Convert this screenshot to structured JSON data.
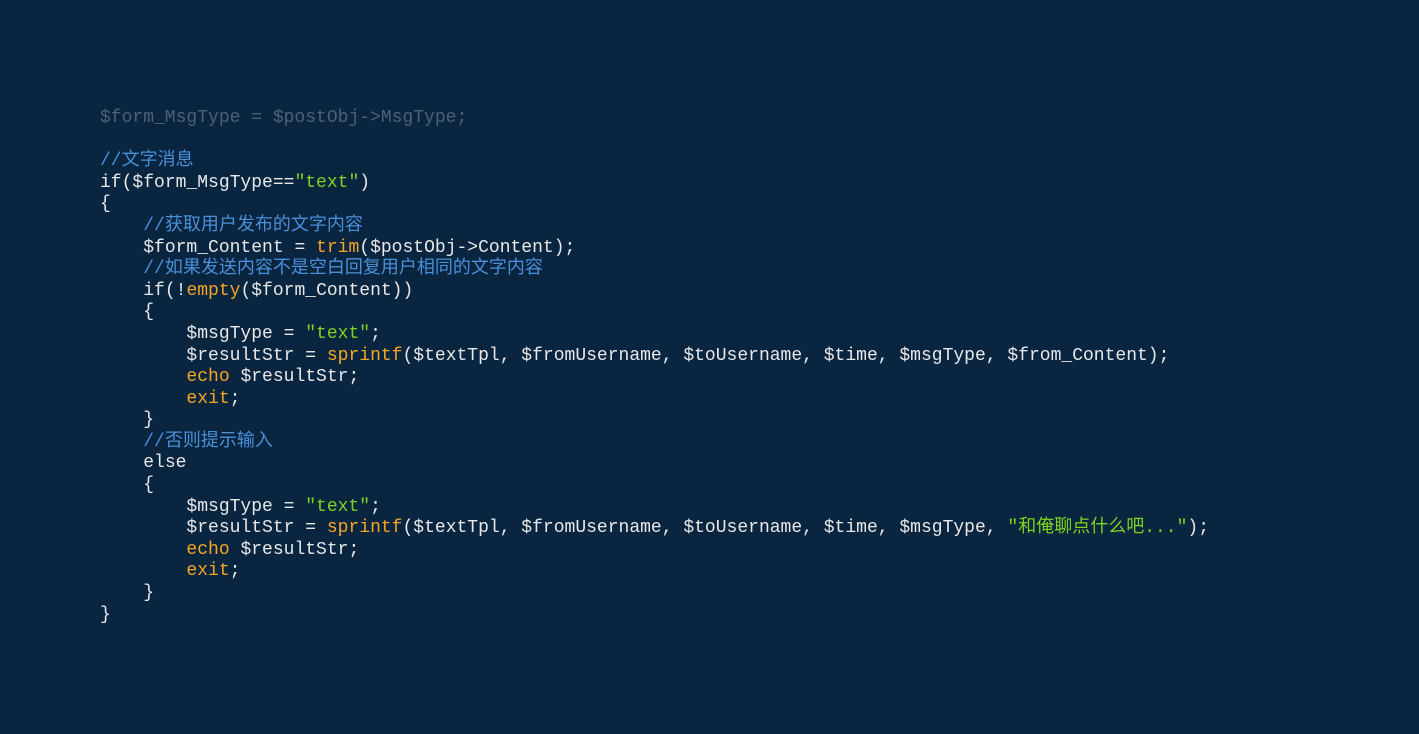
{
  "code": {
    "line0": "$form_MsgType = $postObj->MsgType;",
    "line1_comment": "//文字消息",
    "line2_if": "if",
    "line2_expr": "($form_MsgType==",
    "line2_str": "\"text\"",
    "line2_close": ")",
    "line3": "{",
    "line4_comment": "//获取用户发布的文字内容",
    "line5_var": "$form_Content = ",
    "line5_fn": "trim",
    "line5_args": "($postObj->Content);",
    "line6_comment": "//如果发送内容不是空白回复用户相同的文字内容",
    "line7_if": "if",
    "line7_open": "(!",
    "line7_empty": "empty",
    "line7_args": "($form_Content))",
    "line8": "{",
    "line9_var": "$msgType = ",
    "line9_str": "\"text\"",
    "line9_end": ";",
    "line10_var": "$resultStr = ",
    "line10_fn": "sprintf",
    "line10_args": "($textTpl, $fromUsername, $toUsername, $time, $msgType, $from_Content);",
    "line11_echo": "echo",
    "line11_var": " $resultStr;",
    "line12_exit": "exit",
    "line12_end": ";",
    "line13": "}",
    "line14_comment": "//否则提示输入",
    "line15_else": "else",
    "line16": "{",
    "line17_var": "$msgType = ",
    "line17_str": "\"text\"",
    "line17_end": ";",
    "line18_var": "$resultStr = ",
    "line18_fn": "sprintf",
    "line18_args1": "($textTpl, $fromUsername, $toUsername, $time, $msgType, ",
    "line18_str": "\"和俺聊点什么吧...\"",
    "line18_args2": ");",
    "line19_echo": "echo",
    "line19_var": " $resultStr;",
    "line20_exit": "exit",
    "line20_end": ";",
    "line21": "}",
    "line22": "}"
  }
}
